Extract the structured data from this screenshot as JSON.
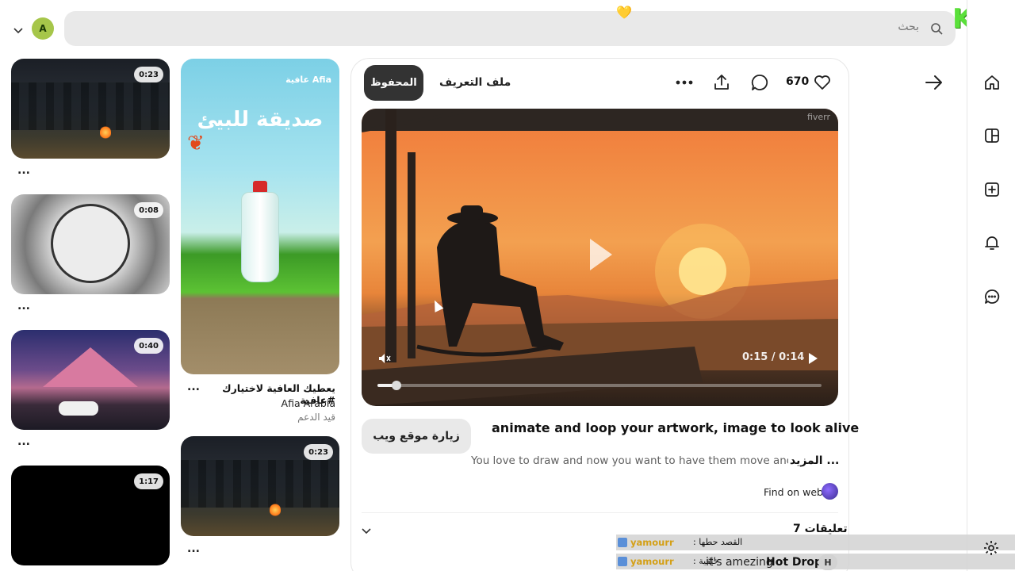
{
  "topbar": {
    "search_placeholder": "بحث",
    "avatar_letter": "A",
    "heart_emoji": "💛"
  },
  "nav_rail": {
    "items": [
      "home-icon",
      "boards-icon",
      "create-icon",
      "notifications-icon",
      "messages-icon"
    ],
    "settings": "settings-icon"
  },
  "pin": {
    "saved_label": "المحفوظ",
    "profile_label": "ملف التعريف",
    "like_count": "670",
    "video": {
      "watermark": "fiverr",
      "time": "0:15 / 0:14",
      "progress": 0.04
    },
    "visit_label": "زيارة موقع ويب",
    "title": "animate and loop your artwork, image to look alive",
    "description": "You love to draw and now you want to have them move and be a",
    "more_label": "المزيد ...",
    "find_on_web": "Find on web",
    "comments_label": "7 تعليقات"
  },
  "feed": {
    "ad": {
      "headline": "صديقة للبيئ",
      "brand": "عافية Afia",
      "caption": "يعطيك العافية لاختيارك #عافية",
      "author": "Afia Arabia",
      "promoted": "قيد الدعم",
      "more": "..."
    },
    "left_column": [
      {
        "duration": "0:23",
        "more": "..."
      },
      {
        "duration": "0:08",
        "more": "..."
      },
      {
        "duration": "0:40",
        "more": "..."
      },
      {
        "duration": "1:17",
        "more": ""
      }
    ],
    "mid_column_video": {
      "duration": "0:23",
      "more": "..."
    }
  },
  "chat": [
    {
      "user": "yamourr",
      "message": ": القصد حطها"
    },
    {
      "user": "yamourr",
      "message": ": خلفية",
      "text": "it's amezing",
      "strong": "Hot Drop",
      "badge": "H"
    }
  ]
}
